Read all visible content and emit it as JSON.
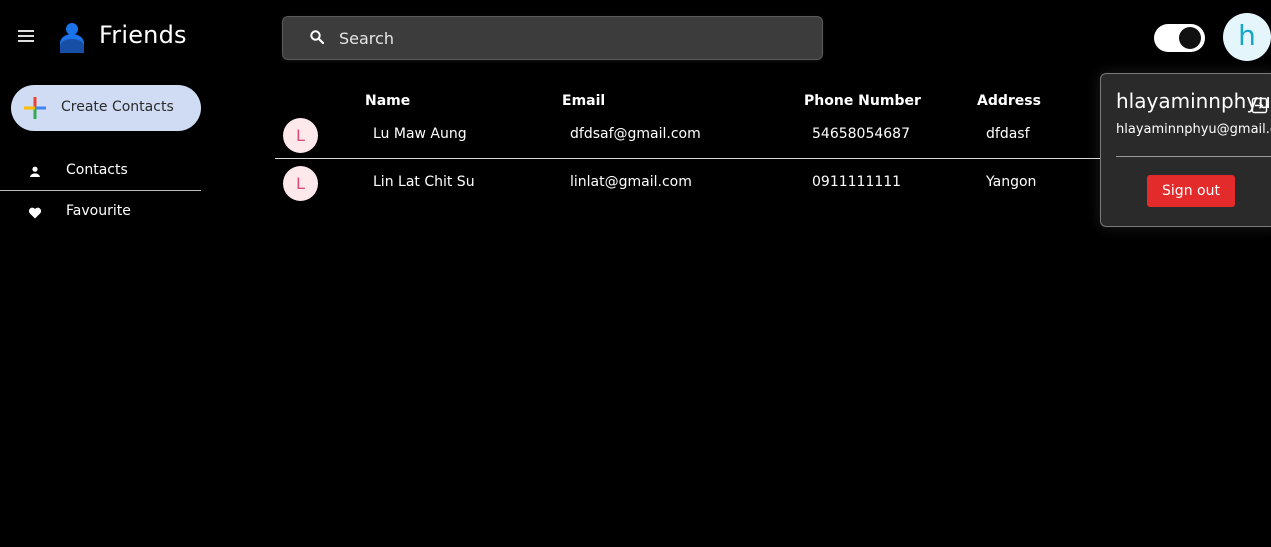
{
  "header": {
    "brand": "Friends",
    "search_placeholder": "Search",
    "theme_toggle": "on",
    "avatar_letter": "h"
  },
  "sidebar": {
    "create_label": "Create Contacts",
    "items": [
      {
        "label": "Contacts",
        "icon": "person-icon"
      },
      {
        "label": "Favourite",
        "icon": "heart-icon"
      }
    ]
  },
  "table": {
    "columns": [
      "Name",
      "Email",
      "Phone Number",
      "Address"
    ],
    "rows": [
      {
        "avatar": "L",
        "name": "Lu Maw Aung",
        "email": "dfdsaf@gmail.com",
        "phone": "54658054687",
        "address": "dfdasf"
      },
      {
        "avatar": "L",
        "name": "Lin Lat Chit Su",
        "email": "linlat@gmail.com",
        "phone": "0911111111",
        "address": "Yangon"
      }
    ]
  },
  "account_popover": {
    "name": "hlayaminnphyu",
    "email": "hlayaminnphyu@gmail.com",
    "signout_label": "Sign out"
  },
  "colors": {
    "background": "#000000",
    "create_button": "#cfdcf4",
    "signout": "#e32b2b",
    "avatar_accent": "#17a7c9",
    "row_avatar_accent": "#e24a77"
  }
}
